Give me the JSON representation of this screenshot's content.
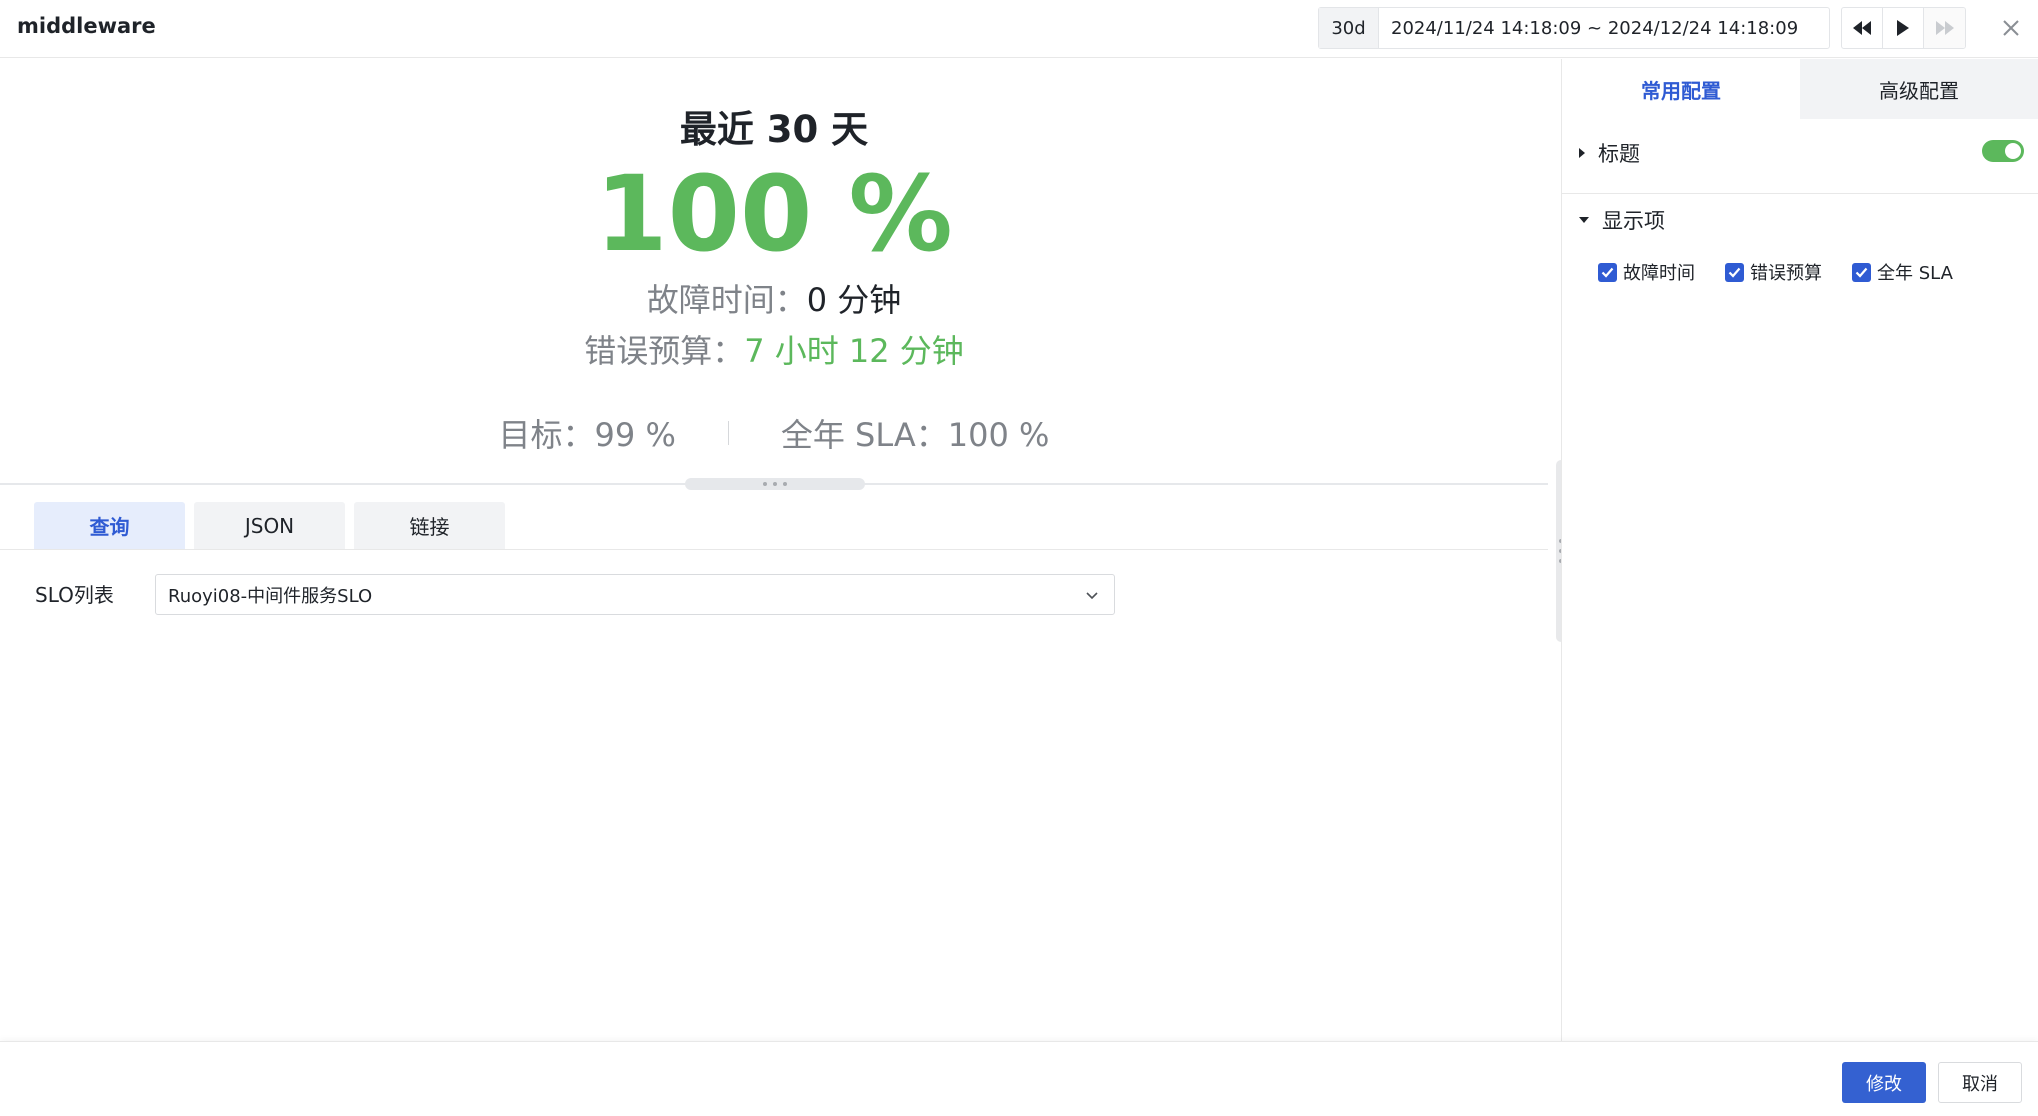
{
  "header": {
    "title": "middleware",
    "range_preset": "30d",
    "range_text": "2024/11/24 14:18:09 ~ 2024/12/24 14:18:09"
  },
  "preview": {
    "title": "最近 30 天",
    "value": "100 %",
    "downtime_label": "故障时间：",
    "downtime_value": "0 分钟",
    "budget_label": "错误预算：",
    "budget_value": "7 小时 12 分钟",
    "target_label": "目标：",
    "target_value": "99 %",
    "annual_label": "全年 SLA：",
    "annual_value": "100 %"
  },
  "query_tabs": [
    {
      "label": "查询",
      "active": true
    },
    {
      "label": "JSON",
      "active": false
    },
    {
      "label": "链接",
      "active": false
    }
  ],
  "slo": {
    "label": "SLO列表",
    "selected": "Ruoyi08-中间件服务SLO"
  },
  "config": {
    "tabs": [
      {
        "label": "常用配置",
        "active": true
      },
      {
        "label": "高级配置",
        "active": false
      }
    ],
    "title_section": {
      "label": "标题",
      "toggle_on": true
    },
    "display_section": {
      "label": "显示项",
      "options": [
        {
          "label": "故障时间",
          "checked": true
        },
        {
          "label": "错误预算",
          "checked": true
        },
        {
          "label": "全年 SLA",
          "checked": true
        }
      ]
    }
  },
  "footer": {
    "submit_label": "修改",
    "cancel_label": "取消"
  },
  "colors": {
    "accent": "#2f5bd3",
    "success": "#5cb85c",
    "primary_button": "#3461d1"
  }
}
